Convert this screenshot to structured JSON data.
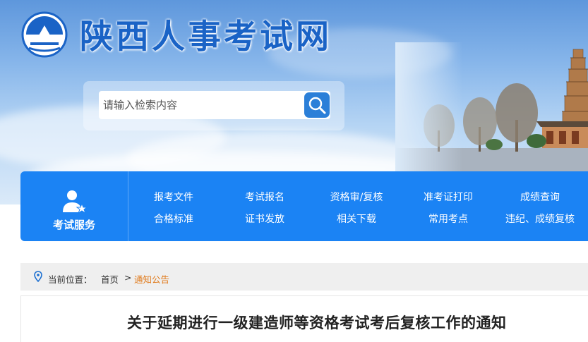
{
  "header": {
    "site_title": "陕西人事考试网",
    "logo_icon": "pagoda-emblem-icon"
  },
  "search": {
    "placeholder": "请输入检索内容",
    "button_icon": "search-icon"
  },
  "service": {
    "title": "考试服务",
    "icon": "user-star-icon",
    "links_row1": [
      "报考文件",
      "考试报名",
      "资格审/复核",
      "准考证打印",
      "成绩查询"
    ],
    "links_row2": [
      "合格标准",
      "证书发放",
      "相关下载",
      "常用考点",
      "违纪、成绩复核"
    ]
  },
  "breadcrumb": {
    "label": "当前位置：",
    "home": "首页",
    "separator": ">",
    "current": "通知公告"
  },
  "article": {
    "title": "关于延期进行一级建造师等资格考试考后复核工作的通知"
  },
  "colors": {
    "brand_blue": "#1b83f4",
    "title_blue": "#1a63c6",
    "breadcrumb_current": "#e07b1d"
  }
}
